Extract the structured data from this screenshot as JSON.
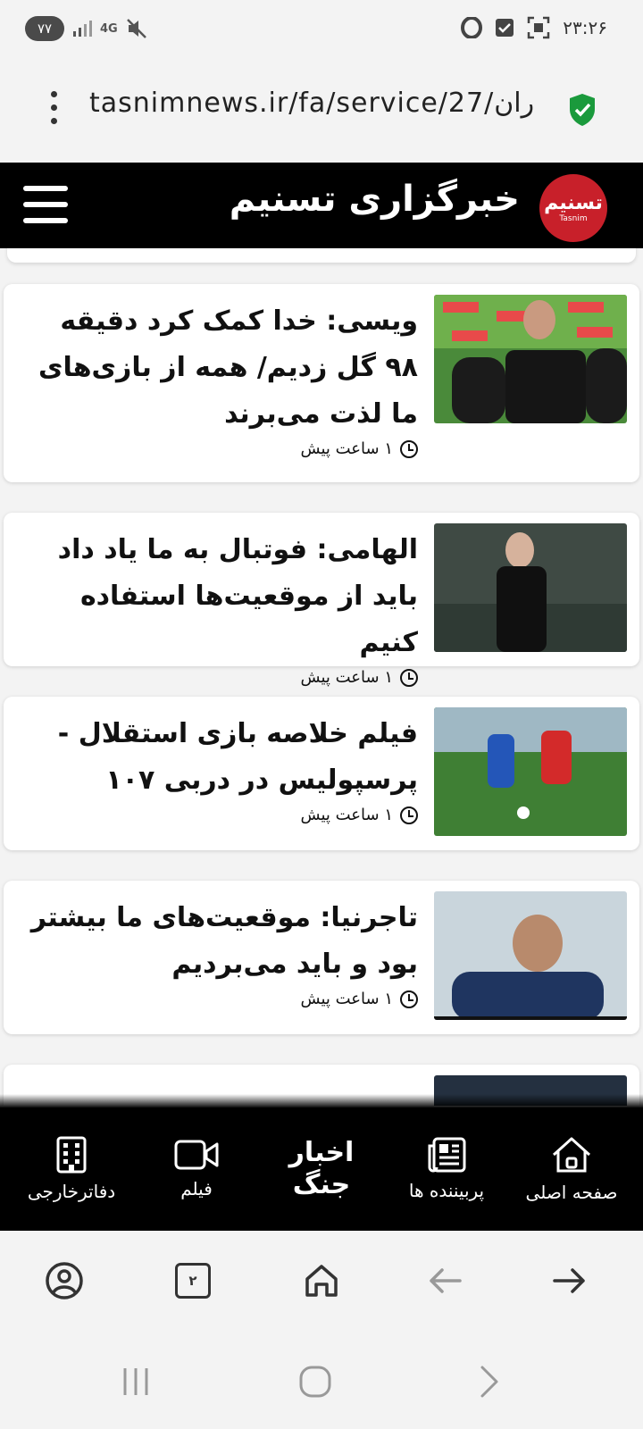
{
  "status_bar": {
    "battery": "۷۷",
    "network": "4G",
    "time": "۲۳:۲۶"
  },
  "browser": {
    "url": "tasnimnews.ir/fa/service/27/ران",
    "tab_count": "۲"
  },
  "site": {
    "title": "خبرگزاری تسنیم",
    "logo_text": "تسنیم",
    "logo_sub": "Tasnim"
  },
  "articles": [
    {
      "headline": "ویسی: خدا کمک کرد دقیقه ۹۸ گل زدیم/ همه از بازی‌های ما لذت می‌برند",
      "time": "۱ ساعت پیش"
    },
    {
      "headline": "الهامی: فوتبال به ما یاد داد باید از موقعیت‌ها استفاده کنیم",
      "time": "۱ ساعت پیش"
    },
    {
      "headline": "فیلم خلاصه بازی استقلال - پرسپولیس در دربی ۱۰۷",
      "time": "۱ ساعت پیش"
    },
    {
      "headline": "تاجرنیا: موقعیت‌های ما بیشتر بود و باید می‌بردیم",
      "time": "۱ ساعت پیش"
    }
  ],
  "bottom_nav": {
    "home": "صفحه اصلی",
    "most_viewed": "پربیننده ها",
    "war_news": "اخبار جنگ",
    "video": "فیلم",
    "foreign_offices": "دفاترخارجی"
  },
  "colors": {
    "brand_red": "#c8202a",
    "header_bg": "#000000",
    "secure_green": "#1a9a3c"
  }
}
